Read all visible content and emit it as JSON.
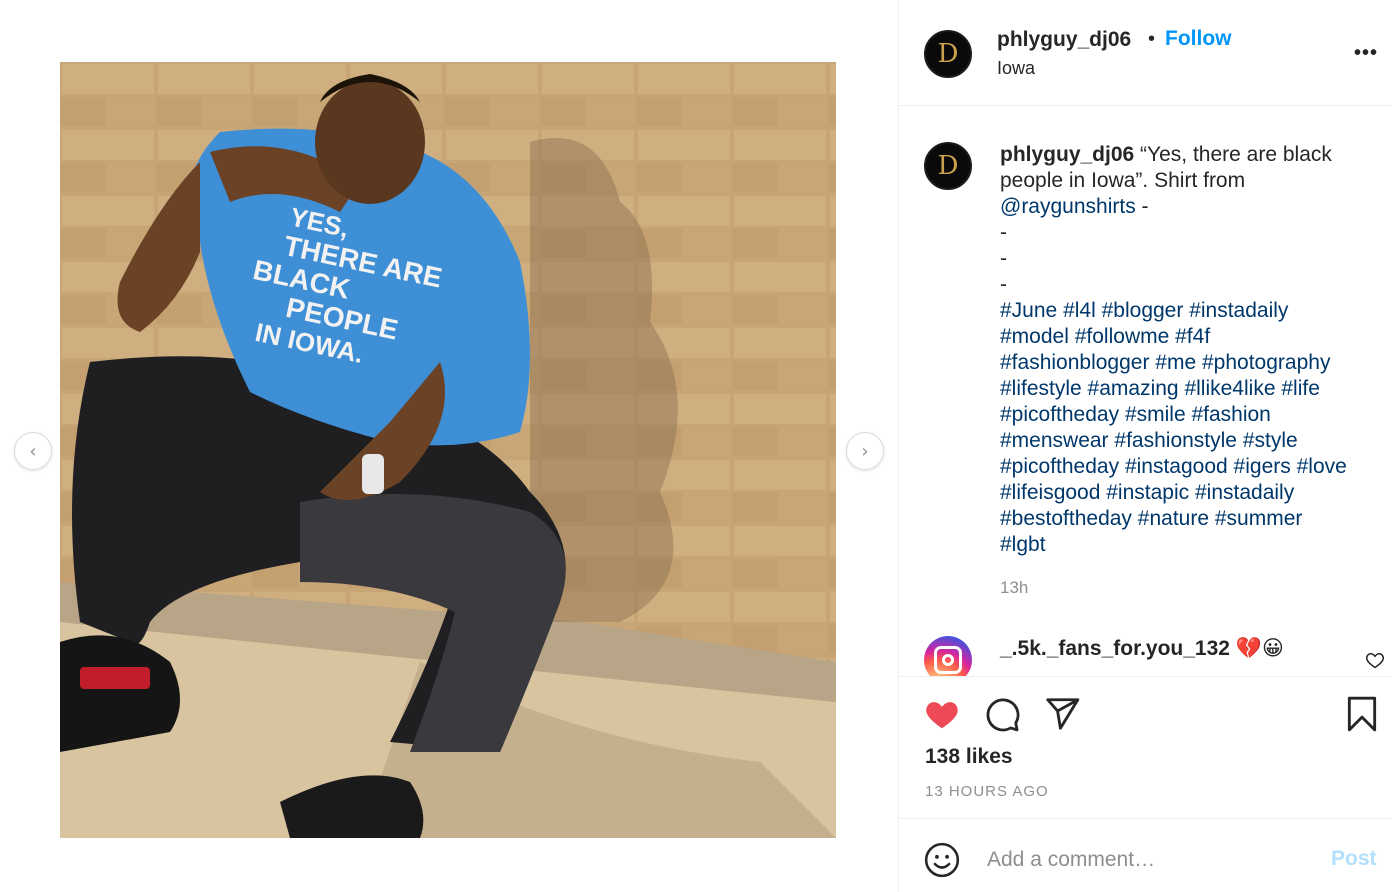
{
  "media": {
    "shirt_text": [
      "YES,",
      "THERE ARE",
      "BLACK",
      "PEOPLE",
      "IN IOWA."
    ],
    "prev_arrow": "‹",
    "next_arrow": "›"
  },
  "header": {
    "avatar_letter": "D",
    "username": "phlyguy_dj06",
    "dot": "•",
    "follow_label": "Follow",
    "location": "Iowa",
    "more_label": "•••"
  },
  "caption": {
    "avatar_letter": "D",
    "username": "phlyguy_dj06",
    "text": "“Yes, there are black people in Iowa”. Shirt from",
    "mention": "@raygunshirts",
    "after_mention": " -",
    "dash_lines": [
      "-",
      "-",
      "-"
    ],
    "hashtags": [
      "#June",
      "#l4l",
      "#blogger",
      "#instadaily",
      "#model",
      "#followme",
      "#f4f",
      "#fashionblogger",
      "#me",
      "#photography",
      "#lifestyle",
      "#amazing",
      "#llike4like",
      "#life",
      "#picoftheday",
      "#smile",
      "#fashion",
      "#menswear",
      "#fashionstyle",
      "#style",
      "#picoftheday",
      "#instagood",
      "#igers",
      "#love",
      "#lifeisgood",
      "#instapic",
      "#instadaily",
      "#bestoftheday",
      "#nature",
      "#summer",
      "#lgbt"
    ],
    "time": "13h"
  },
  "comment": {
    "username": "_.5k._fans_for.you_132",
    "text": "💔😀"
  },
  "actions": {
    "likes": "138 likes",
    "date": "13 HOURS AGO"
  },
  "comment_box": {
    "placeholder": "Add a comment…",
    "post_label": "Post"
  },
  "colors": {
    "accent": "#0095f6",
    "hashtag": "#00376b",
    "like_red": "#ed4956",
    "muted": "#8e8e8e",
    "post_disabled": "#b2dffc"
  }
}
